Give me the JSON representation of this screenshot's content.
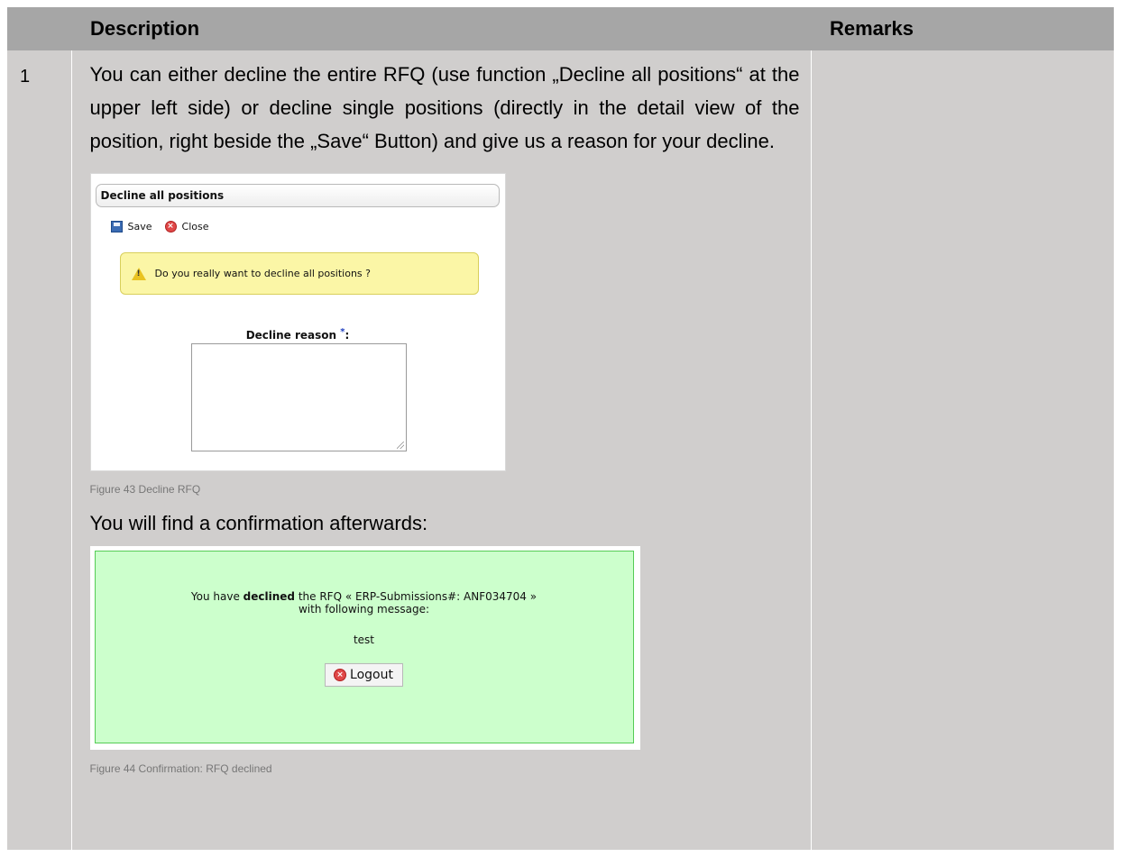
{
  "table": {
    "header": {
      "description": "Description",
      "remarks": "Remarks"
    },
    "row": {
      "number": "1",
      "paragraph": "You can either decline the entire RFQ (use function „Decline all positions“ at the upper left side) or decline single positions (directly in the detail view of the position, right beside the „Save“ Button) and give us a reason for your decline.",
      "figure43_caption": "Figure 43 Decline RFQ",
      "confirm_paragraph": "You will find a confirmation afterwards:",
      "figure44_caption": "Figure 44 Confirmation: RFQ declined",
      "remarks": ""
    }
  },
  "decline_dialog": {
    "title": "Decline all positions",
    "save_label": "Save",
    "close_label": "Close",
    "warning_text": "Do you really want to decline all positions ?",
    "reason_label": "Decline reason ",
    "required_marker": "*",
    "reason_colon": ":",
    "reason_value": "",
    "icons": {
      "save": "save-icon",
      "close": "close-icon",
      "warning": "warning-icon"
    }
  },
  "confirmation": {
    "line1_prefix": "You have ",
    "line1_bold": "declined",
    "line1_suffix": " the RFQ « ERP-Submissions#: ANF034704 »",
    "line2": "with following message:",
    "message": "test",
    "logout_label": "Logout",
    "icons": {
      "logout": "logout-icon"
    }
  },
  "colors": {
    "header_bg": "#a6a6a6",
    "row_bg": "#d0cecd",
    "warning_bg": "#fbf6a6",
    "confirm_bg": "#ccffcc",
    "confirm_border": "#55cc55"
  }
}
